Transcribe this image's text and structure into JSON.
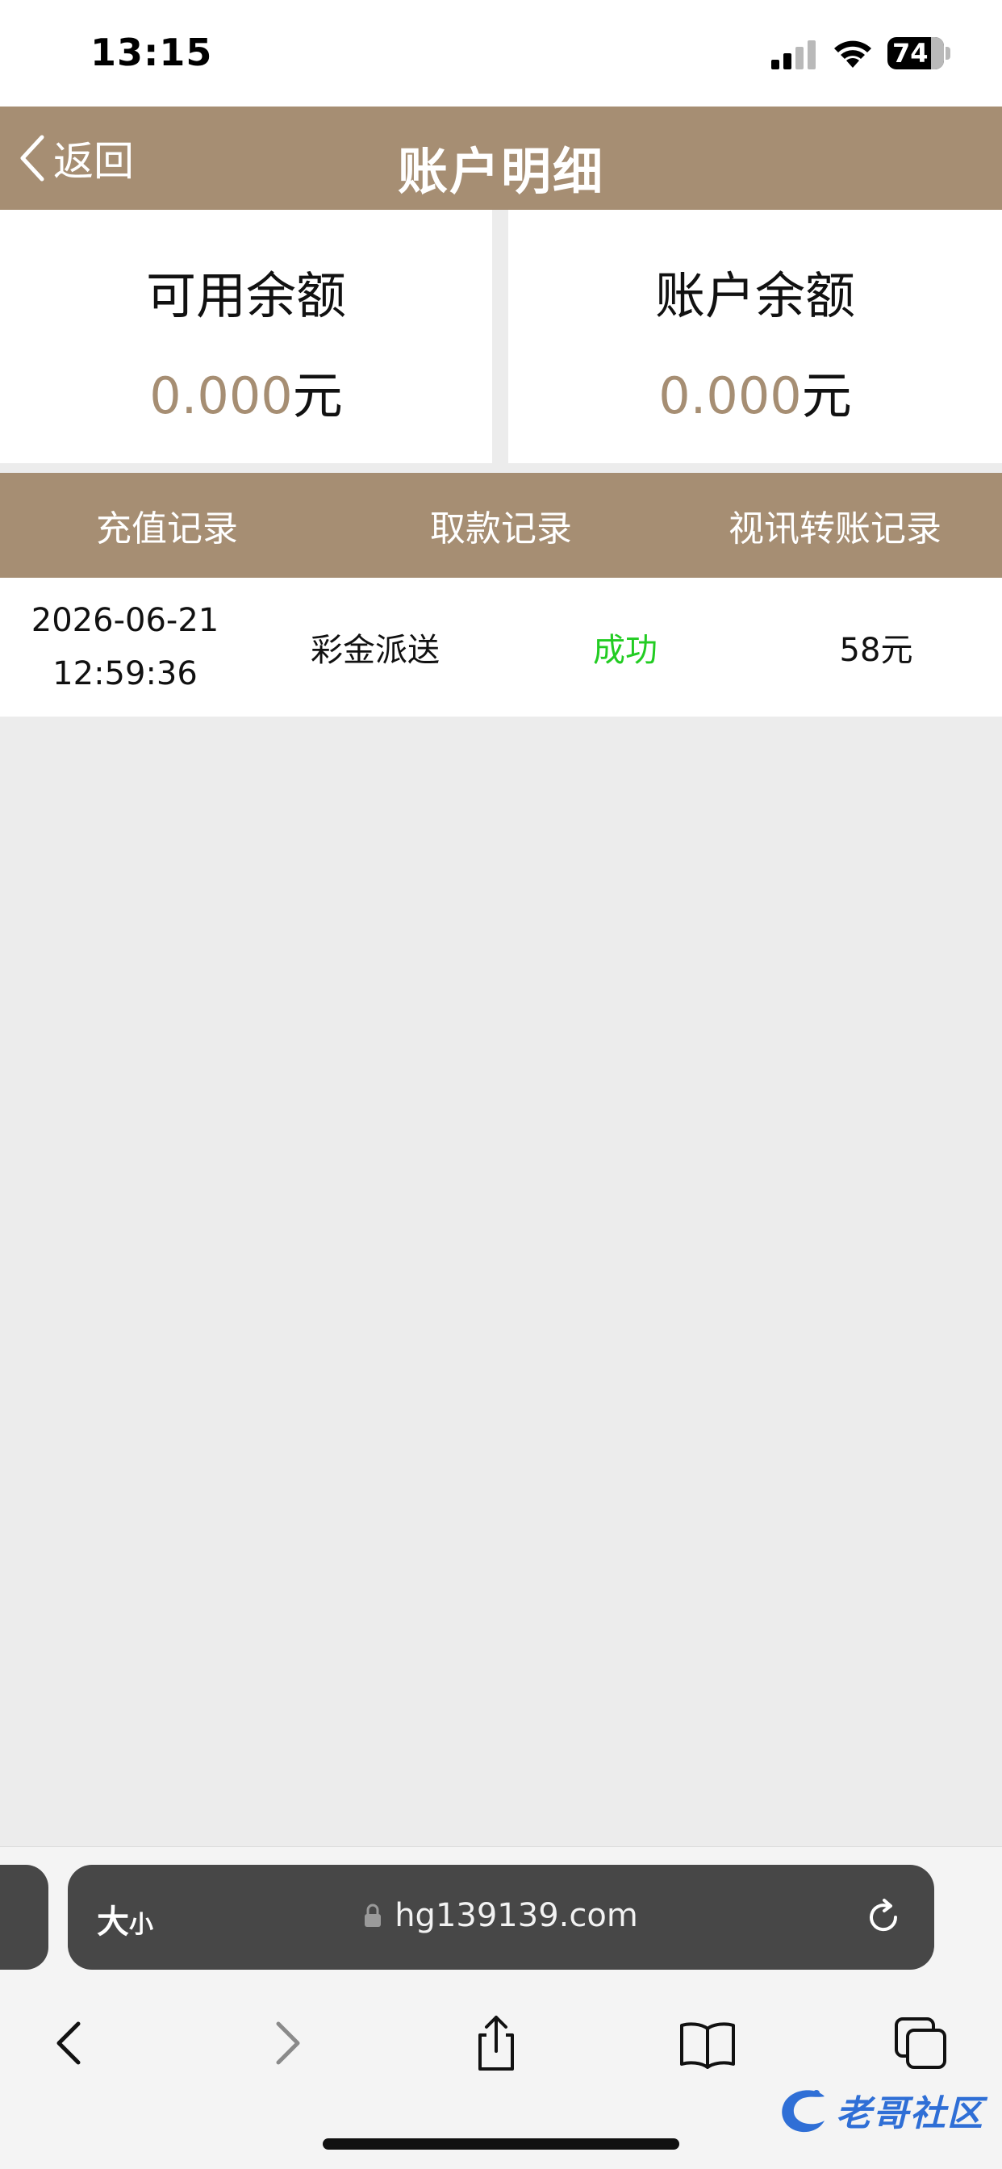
{
  "status_bar": {
    "time": "13:15",
    "battery": "74",
    "icons": [
      "signal-icon",
      "wifi-icon",
      "battery-icon"
    ]
  },
  "header": {
    "back_label": "返回",
    "title": "账户明细"
  },
  "balances": {
    "available_label": "可用余额",
    "available_amount": "0.000",
    "available_unit": "元",
    "account_label": "账户余额",
    "account_amount": "0.000",
    "account_unit": "元"
  },
  "tabs": [
    {
      "label": "充值记录"
    },
    {
      "label": "取款记录"
    },
    {
      "label": "视讯转账记录"
    }
  ],
  "records": [
    {
      "date": "2026-06-21",
      "time": "12:59:36",
      "description": "彩金派送",
      "status": "成功",
      "amount": "58元"
    }
  ],
  "browser": {
    "text_size_big": "大",
    "text_size_small": "小",
    "url": "hg139139.com"
  },
  "watermark": {
    "text": "老哥社区"
  },
  "colors": {
    "brand": "#a68e73",
    "success": "#22cc22",
    "background": "#ececec"
  }
}
